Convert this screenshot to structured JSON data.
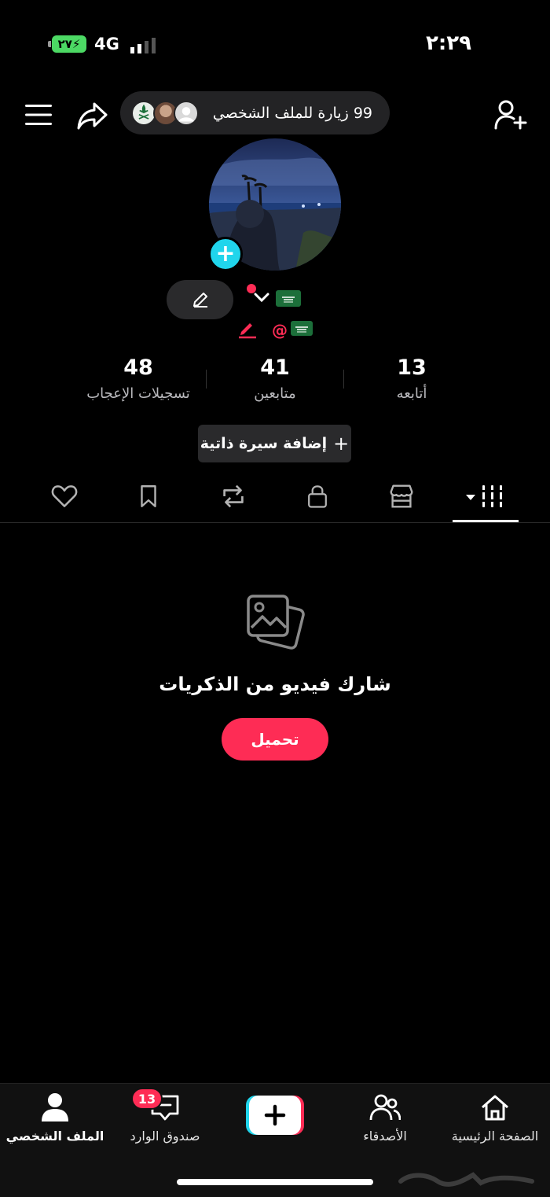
{
  "status_bar": {
    "battery": "٢٧",
    "network": "4G",
    "time": "٢:٢٩"
  },
  "header": {
    "visits_text": "99 زيارة للملف الشخصي",
    "icons": [
      "menu-icon",
      "share-icon",
      "add-user-icon"
    ]
  },
  "profile": {
    "at_sign": "@",
    "flag_icon": "saudi-flag-icon"
  },
  "stats": [
    {
      "value": "13",
      "label": "أتابعه"
    },
    {
      "value": "41",
      "label": "متابعين"
    },
    {
      "value": "48",
      "label": "تسجيلات الإعجاب"
    }
  ],
  "bio_button": {
    "plus": "+",
    "label": "إضافة سيرة ذاتية"
  },
  "tabs": [
    "videos-grid-icon",
    "shop-icon",
    "lock-icon",
    "repost-icon",
    "bookmark-icon",
    "heart-icon"
  ],
  "empty_state": {
    "title": "شارك فيديو من الذكريات",
    "button": "تحميل"
  },
  "bottom_nav": {
    "home": "الصفحة الرئيسية",
    "friends": "الأصدقاء",
    "create_icon": "plus-icon",
    "inbox": "صندوق الوارد",
    "inbox_badge": "13",
    "profile": "الملف الشخصي"
  },
  "colors": {
    "accent": "#fe2c55",
    "cyan": "#20d5ec",
    "background": "#000000",
    "surface": "#2a2a2c"
  }
}
